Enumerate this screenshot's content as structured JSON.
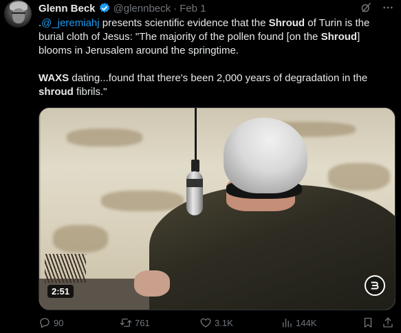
{
  "author": {
    "name": "Glenn Beck",
    "handle": "@glennbeck",
    "separator": "·",
    "date": "Feb 1"
  },
  "tweet": {
    "p1_prefix": ".",
    "mention": "@_jeremiahj",
    "p1_a": " presents scientific evidence that the ",
    "p1_b1": "Shroud",
    "p1_c": " of Turin is the burial cloth of Jesus: \"The majority of the pollen found [on the ",
    "p1_b2": "Shroud",
    "p1_d": "] blooms in Jerusalem around the springtime.",
    "p2_b1": "WAXS",
    "p2_a": " dating...found that there's been 2,000 years of degradation in the ",
    "p2_b2": "shroud",
    "p2_b": " fibrils.\""
  },
  "media": {
    "duration": "2:51"
  },
  "actions": {
    "replies": "90",
    "reposts": "761",
    "likes": "3.1K",
    "views": "144K"
  },
  "colors": {
    "accent": "#1d9bf0",
    "muted": "#71767b",
    "text": "#e7e9ea",
    "background": "#000000"
  },
  "icons": [
    "grok-icon",
    "more-icon",
    "verified-icon",
    "reply-icon",
    "retweet-icon",
    "like-icon",
    "views-icon",
    "bookmark-icon",
    "share-icon",
    "brand-logo-icon"
  ]
}
